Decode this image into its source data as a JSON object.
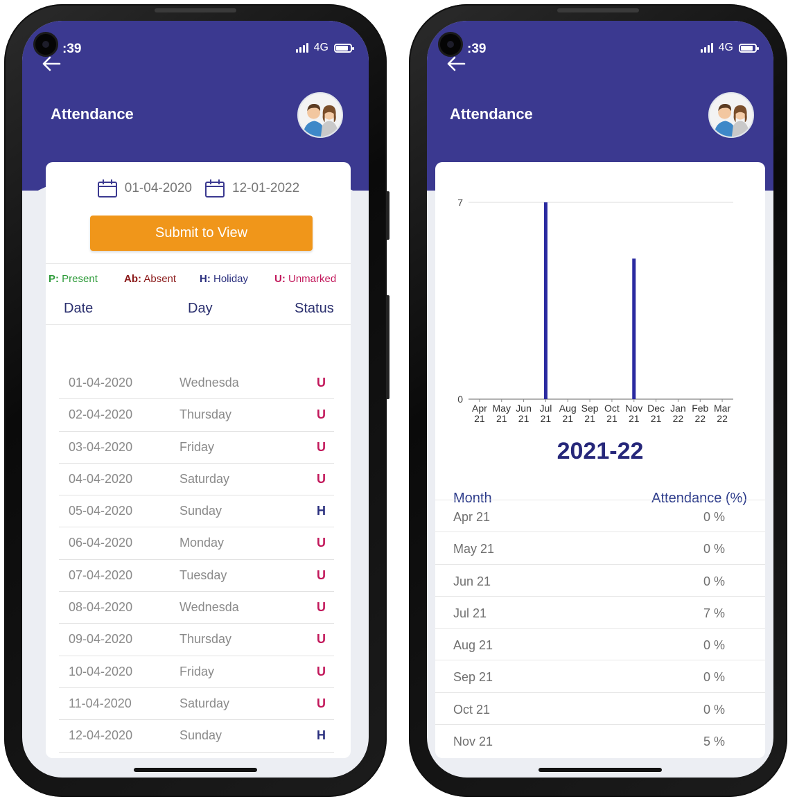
{
  "status_bar": {
    "time": ":39",
    "network": "4G"
  },
  "header": {
    "title": "Attendance"
  },
  "attendance": {
    "from_date": "01-04-2020",
    "to_date": "12-01-2022",
    "submit_label": "Submit to View",
    "legend": [
      {
        "key": "P:",
        "label": "Present",
        "color": "#2e9b3a"
      },
      {
        "key": "Ab:",
        "label": "Absent",
        "color": "#8b1a1a"
      },
      {
        "key": "H:",
        "label": "Holiday",
        "color": "#2a2f7e"
      },
      {
        "key": "U:",
        "label": "Unmarked",
        "color": "#c2185b"
      }
    ],
    "columns": [
      "Date",
      "Day",
      "Status"
    ],
    "rows": [
      {
        "date": "01-04-2020",
        "day": "Wednesda",
        "status": "U"
      },
      {
        "date": "02-04-2020",
        "day": "Thursday",
        "status": "U"
      },
      {
        "date": "03-04-2020",
        "day": "Friday",
        "status": "U"
      },
      {
        "date": "04-04-2020",
        "day": "Saturday",
        "status": "U"
      },
      {
        "date": "05-04-2020",
        "day": "Sunday",
        "status": "H"
      },
      {
        "date": "06-04-2020",
        "day": "Monday",
        "status": "U"
      },
      {
        "date": "07-04-2020",
        "day": "Tuesday",
        "status": "U"
      },
      {
        "date": "08-04-2020",
        "day": "Wednesda",
        "status": "U"
      },
      {
        "date": "09-04-2020",
        "day": "Thursday",
        "status": "U"
      },
      {
        "date": "10-04-2020",
        "day": "Friday",
        "status": "U"
      },
      {
        "date": "11-04-2020",
        "day": "Saturday",
        "status": "U"
      },
      {
        "date": "12-04-2020",
        "day": "Sunday",
        "status": "H"
      }
    ]
  },
  "summary": {
    "year_label": "2021-22",
    "columns": [
      "Month",
      "Attendance (%)"
    ],
    "rows": [
      {
        "month": "Apr 21",
        "value": "0 %"
      },
      {
        "month": "May 21",
        "value": "0 %"
      },
      {
        "month": "Jun 21",
        "value": "0 %"
      },
      {
        "month": "Jul 21",
        "value": "7 %"
      },
      {
        "month": "Aug 21",
        "value": "0 %"
      },
      {
        "month": "Sep 21",
        "value": "0 %"
      },
      {
        "month": "Oct 21",
        "value": "0 %"
      },
      {
        "month": "Nov 21",
        "value": "5 %"
      }
    ]
  },
  "chart_data": {
    "type": "bar",
    "categories": [
      "Apr 21",
      "May 21",
      "Jun 21",
      "Jul 21",
      "Aug 21",
      "Sep 21",
      "Oct 21",
      "Nov 21",
      "Dec 21",
      "Jan 22",
      "Feb 22",
      "Mar 22"
    ],
    "values": [
      0,
      0,
      0,
      7,
      0,
      0,
      0,
      5,
      0,
      0,
      0,
      0
    ],
    "ylim": [
      0,
      7
    ],
    "y_ticks": [
      "0",
      "7"
    ],
    "title": "",
    "xlabel": "",
    "ylabel": "",
    "bar_color": "#2a2aa0",
    "grid": true
  },
  "colors": {
    "header": "#3b3990",
    "accent": "#f0961a",
    "unmarked": "#c2185b",
    "holiday": "#2a2f7e"
  }
}
